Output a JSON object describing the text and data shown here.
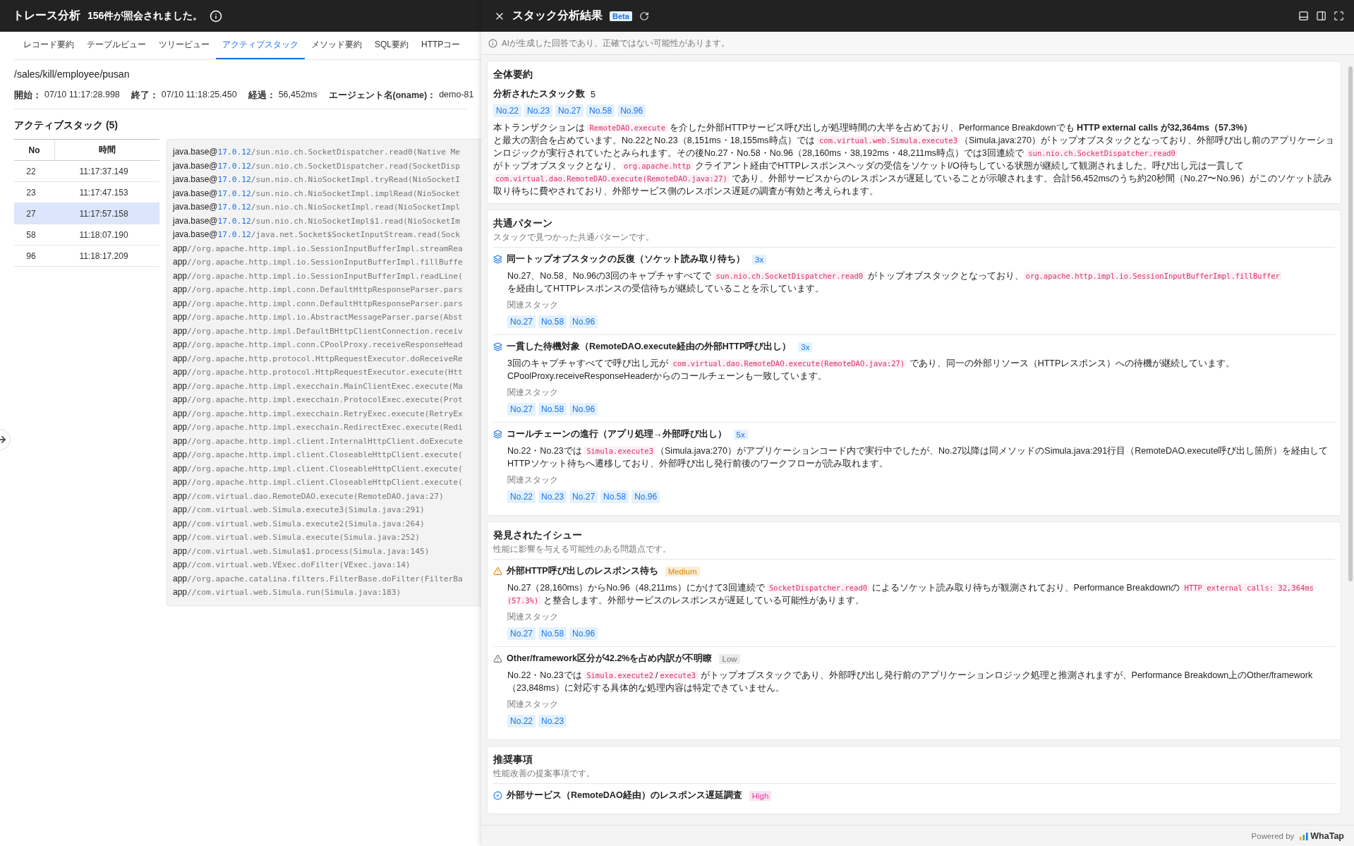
{
  "left": {
    "header": {
      "title": "トレース分析",
      "subtitle": "156件が照会されました。"
    },
    "tabs": [
      {
        "label": "レコード要約",
        "selected": false
      },
      {
        "label": "テーブルビュー",
        "selected": false
      },
      {
        "label": "ツリービュー",
        "selected": false
      },
      {
        "label": "アクティブスタック",
        "selected": true
      },
      {
        "label": "メソッド要約",
        "selected": false
      },
      {
        "label": "SQL要約",
        "selected": false
      },
      {
        "label": "HTTPコー",
        "selected": false
      }
    ],
    "path": "/sales/kill/employee/pusan",
    "meta": [
      {
        "label": "開始：",
        "value": "07/10 11:17:28.998"
      },
      {
        "label": "終了：",
        "value": "07/10 11:18:25.450"
      },
      {
        "label": "経過：",
        "value": "56,452ms"
      },
      {
        "label": "エージェント名(oname)：",
        "value": "demo-81"
      }
    ],
    "section_title": "アクティブスタック (5)",
    "table": {
      "columns": [
        "No",
        "時間"
      ],
      "rows": [
        {
          "no": "22",
          "time": "11:17:37.149",
          "selected": false
        },
        {
          "no": "23",
          "time": "11:17:47.153",
          "selected": false
        },
        {
          "no": "27",
          "time": "11:17:57.158",
          "selected": true
        },
        {
          "no": "58",
          "time": "11:18:07.190",
          "selected": false
        },
        {
          "no": "96",
          "time": "11:18:17.209",
          "selected": false
        }
      ]
    },
    "stack_lines": [
      {
        "head": "java.base@",
        "version": "17.0.12",
        "tail": "/sun.nio.ch.SocketDispatcher.read0(Native Me"
      },
      {
        "head": "java.base@",
        "version": "17.0.12",
        "tail": "/sun.nio.ch.SocketDispatcher.read(SocketDisp"
      },
      {
        "head": "java.base@",
        "version": "17.0.12",
        "tail": "/sun.nio.ch.NioSocketImpl.tryRead(NioSocketI"
      },
      {
        "head": "java.base@",
        "version": "17.0.12",
        "tail": "/sun.nio.ch.NioSocketImpl.implRead(NioSocket"
      },
      {
        "head": "java.base@",
        "version": "17.0.12",
        "tail": "/sun.nio.ch.NioSocketImpl.read(NioSocketImpl"
      },
      {
        "head": "java.base@",
        "version": "17.0.12",
        "tail": "/sun.nio.ch.NioSocketImpl$1.read(NioSocketIm"
      },
      {
        "head": "java.base@",
        "version": "17.0.12",
        "tail": "/java.net.Socket$SocketInputStream.read(Sock"
      },
      {
        "head": "app",
        "tail": "//org.apache.http.impl.io.SessionInputBufferImpl.streamRea"
      },
      {
        "head": "app",
        "tail": "//org.apache.http.impl.io.SessionInputBufferImpl.fillBuffe"
      },
      {
        "head": "app",
        "tail": "//org.apache.http.impl.io.SessionInputBufferImpl.readLine("
      },
      {
        "head": "app",
        "tail": "//org.apache.http.impl.conn.DefaultHttpResponseParser.pars"
      },
      {
        "head": "app",
        "tail": "//org.apache.http.impl.conn.DefaultHttpResponseParser.pars"
      },
      {
        "head": "app",
        "tail": "//org.apache.http.impl.io.AbstractMessageParser.parse(Abst"
      },
      {
        "head": "app",
        "tail": "//org.apache.http.impl.DefaultBHttpClientConnection.receiv"
      },
      {
        "head": "app",
        "tail": "//org.apache.http.impl.conn.CPoolProxy.receiveResponseHead"
      },
      {
        "head": "app",
        "tail": "//org.apache.http.protocol.HttpRequestExecutor.doReceiveRe"
      },
      {
        "head": "app",
        "tail": "//org.apache.http.protocol.HttpRequestExecutor.execute(Htt"
      },
      {
        "head": "app",
        "tail": "//org.apache.http.impl.execchain.MainClientExec.execute(Ma"
      },
      {
        "head": "app",
        "tail": "//org.apache.http.impl.execchain.ProtocolExec.execute(Prot"
      },
      {
        "head": "app",
        "tail": "//org.apache.http.impl.execchain.RetryExec.execute(RetryEx"
      },
      {
        "head": "app",
        "tail": "//org.apache.http.impl.execchain.RedirectExec.execute(Redi"
      },
      {
        "head": "app",
        "tail": "//org.apache.http.impl.client.InternalHttpClient.doExecute"
      },
      {
        "head": "app",
        "tail": "//org.apache.http.impl.client.CloseableHttpClient.execute("
      },
      {
        "head": "app",
        "tail": "//org.apache.http.impl.client.CloseableHttpClient.execute("
      },
      {
        "head": "app",
        "tail": "//org.apache.http.impl.client.CloseableHttpClient.execute("
      },
      {
        "head": "app",
        "tail": "//com.virtual.dao.RemoteDAO.execute(RemoteDAO.java:27)"
      },
      {
        "head": "app",
        "tail": "//com.virtual.web.Simula.execute3(Simula.java:291)"
      },
      {
        "head": "app",
        "tail": "//com.virtual.web.Simula.execute2(Simula.java:264)"
      },
      {
        "head": "app",
        "tail": "//com.virtual.web.Simula.execute(Simula.java:252)"
      },
      {
        "head": "app",
        "tail": "//com.virtual.web.Simula$1.process(Simula.java:145)"
      },
      {
        "head": "app",
        "tail": "//com.virtual.web.VExec.doFilter(VExec.java:14)"
      },
      {
        "head": "app",
        "tail": "//org.apache.catalina.filters.FilterBase.doFilter(FilterBa"
      },
      {
        "head": "app",
        "tail": "//com.virtual.web.Simula.run(Simula.java:183)"
      }
    ]
  },
  "panel": {
    "title": "スタック分析結果",
    "badge": "Beta",
    "notice": "AIが生成した回答であり、正確ではない可能性があります。",
    "summary": {
      "title": "全体要約",
      "count_label": "分析されたスタック数",
      "count": "5",
      "stacks": [
        "No.22",
        "No.23",
        "No.27",
        "No.58",
        "No.96"
      ],
      "text": [
        {
          "kind": "text",
          "text": "本トランザクションは "
        },
        {
          "kind": "code",
          "text": "RemoteDAO.execute"
        },
        {
          "kind": "text",
          "text": " を介した外部HTTPサービス呼び出しが処理時間の大半を占めており、Performance Breakdownでも "
        },
        {
          "kind": "bold",
          "text": "HTTP external calls が32,364ms（57.3%）"
        },
        {
          "kind": "text",
          "text": "\nと最大の割合を占めています。No.22とNo.23（8,151ms・18,155ms時点）では "
        },
        {
          "kind": "code",
          "text": "com.virtual.web.Simula.execute3"
        },
        {
          "kind": "text",
          "text": "（Simula.java:270）がトップオブスタックとなっており、外部呼び出し前のアプリケーションロジックが実行されていたとみられます。その後No.27・No.58・No.96（28,160ms・38,192ms・48,211ms時点）では3回連続で "
        },
        {
          "kind": "code",
          "text": "sun.nio.ch.SocketDispatcher.read0"
        },
        {
          "kind": "text",
          "text": "\nがトップオブスタックとなり、"
        },
        {
          "kind": "code",
          "text": "org.apache.http"
        },
        {
          "kind": "text",
          "text": " クライアント経由でHTTPレスポンスヘッダの受信をソケットI/O待ちしている状態が継続して観測されました。呼び出し元は一貫して\n"
        },
        {
          "kind": "code",
          "text": "com.virtual.dao.RemoteDAO.execute(RemoteDAO.java:27)"
        },
        {
          "kind": "text",
          "text": " であり、外部サービスからのレスポンスが遅延していることが示唆されます。合計56,452msのうち約20秒間（No.27〜No.96）がこのソケット読み取り待ちに費やされており、外部サービス側のレスポンス遅延の調査が有効と考えられます。"
        }
      ]
    },
    "patterns": {
      "title": "共通パターン",
      "subtitle": "スタックで見つかった共通パターンです。",
      "items": [
        {
          "title": "同一トップオブスタックの反復（ソケット読み取り待ち）",
          "count": "3x",
          "related_label": "関連スタック",
          "stacks": [
            "No.27",
            "No.58",
            "No.96"
          ],
          "text": [
            {
              "kind": "text",
              "text": "No.27、No.58、No.96の3回のキャプチャすべてで "
            },
            {
              "kind": "code",
              "text": "sun.nio.ch.SocketDispatcher.read0"
            },
            {
              "kind": "text",
              "text": " がトップオブスタックとなっており、"
            },
            {
              "kind": "code",
              "text": "org.apache.http.impl.io.SessionInputBufferImpl.fillBuffer"
            },
            {
              "kind": "text",
              "text": "\nを経由してHTTPレスポンスの受信待ちが継続していることを示しています。"
            }
          ]
        },
        {
          "title": "一貫した待機対象（RemoteDAO.execute経由の外部HTTP呼び出し）",
          "count": "3x",
          "related_label": "関連スタック",
          "stacks": [
            "No.27",
            "No.58",
            "No.96"
          ],
          "text": [
            {
              "kind": "text",
              "text": "3回のキャプチャすべてで呼び出し元が "
            },
            {
              "kind": "code",
              "text": "com.virtual.dao.RemoteDAO.execute(RemoteDAO.java:27)"
            },
            {
              "kind": "text",
              "text": " であり、同一の外部リソース（HTTPレスポンス）への待機が継続しています。\nCPoolProxy.receiveResponseHeaderからのコールチェーンも一致しています。"
            }
          ]
        },
        {
          "title": "コールチェーンの進行（アプリ処理→外部呼び出し）",
          "count": "5x",
          "related_label": "関連スタック",
          "stacks": [
            "No.22",
            "No.23",
            "No.27",
            "No.58",
            "No.96"
          ],
          "text": [
            {
              "kind": "text",
              "text": "No.22・No.23では "
            },
            {
              "kind": "code",
              "text": "Simula.execute3"
            },
            {
              "kind": "text",
              "text": "（Simula.java:270）がアプリケーションコード内で実行中でしたが、No.27以降は同メソッドのSimula.java:291行目（RemoteDAO.execute呼び出し箇所）を経由してHTTPソケット待ちへ遷移しており、外部呼び出し発行前後のワークフローが読み取れます。"
            }
          ]
        }
      ]
    },
    "issues": {
      "title": "発見されたイシュー",
      "subtitle": "性能に影響を与える可能性のある問題点です。",
      "items": [
        {
          "title": "外部HTTP呼び出しのレスポンス待ち",
          "color": "#d98a00",
          "badge": "Medium",
          "related_label": "関連スタック",
          "stacks": [
            "No.27",
            "No.58",
            "No.96"
          ],
          "text": [
            {
              "kind": "text",
              "text": "No.27（28,160ms）からNo.96（48,211ms）にかけて3回連続で "
            },
            {
              "kind": "code",
              "text": "SocketDispatcher.read0"
            },
            {
              "kind": "text",
              "text": " によるソケット読み取り待ちが観測されており、Performance Breakdownの "
            },
            {
              "kind": "code",
              "text": "HTTP external calls: 32,364ms (57.3%)"
            },
            {
              "kind": "text",
              "text": " と整合します。外部サービスのレスポンスが遅延している可能性があります。"
            }
          ]
        },
        {
          "title": "Other/framework区分が42.2%を占め内訳が不明瞭",
          "color": "#777777",
          "badge": "Low",
          "related_label": "関連スタック",
          "stacks": [
            "No.22",
            "No.23"
          ],
          "text": [
            {
              "kind": "text",
              "text": "No.22・No.23では "
            },
            {
              "kind": "code",
              "text": "Simula.execute2"
            },
            {
              "kind": "text",
              "text": "/"
            },
            {
              "kind": "code",
              "text": "execute3"
            },
            {
              "kind": "text",
              "text": " がトップオブスタックであり、外部呼び出し発行前のアプリケーションロジック処理と推測されますが、Performance Breakdown上のOther/framework（23,848ms）に対応する具体的な処理内容は特定できていません。"
            }
          ]
        }
      ]
    },
    "recommendations": {
      "title": "推奨事項",
      "subtitle": "性能改善の提案事項です。",
      "items": [
        {
          "title": "外部サービス（RemoteDAO経由）のレスポンス遅延調査",
          "color": "#e040a0",
          "badge": "High"
        }
      ]
    }
  },
  "footer": {
    "powered": "Powered by",
    "brand": "WhaTap"
  }
}
